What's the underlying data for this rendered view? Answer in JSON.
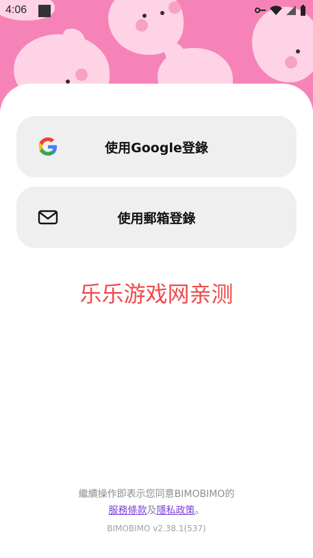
{
  "status_bar": {
    "time": "4:06"
  },
  "login": {
    "google_label": "使用Google登錄",
    "email_label": "使用郵箱登錄"
  },
  "watermark": "乐乐游戏网亲测",
  "footer": {
    "notice": "繼續操作即表示您同意BIMOBIMO的",
    "terms_link": "服務條款",
    "and": "及",
    "privacy_link": "隱私政策",
    "end": "。",
    "version": "BIMOBIMO v2.38.1(537)"
  },
  "colors": {
    "hero_bg": "#f683b8",
    "watermark": "#ee4b4b",
    "link": "#7a3fd6"
  }
}
